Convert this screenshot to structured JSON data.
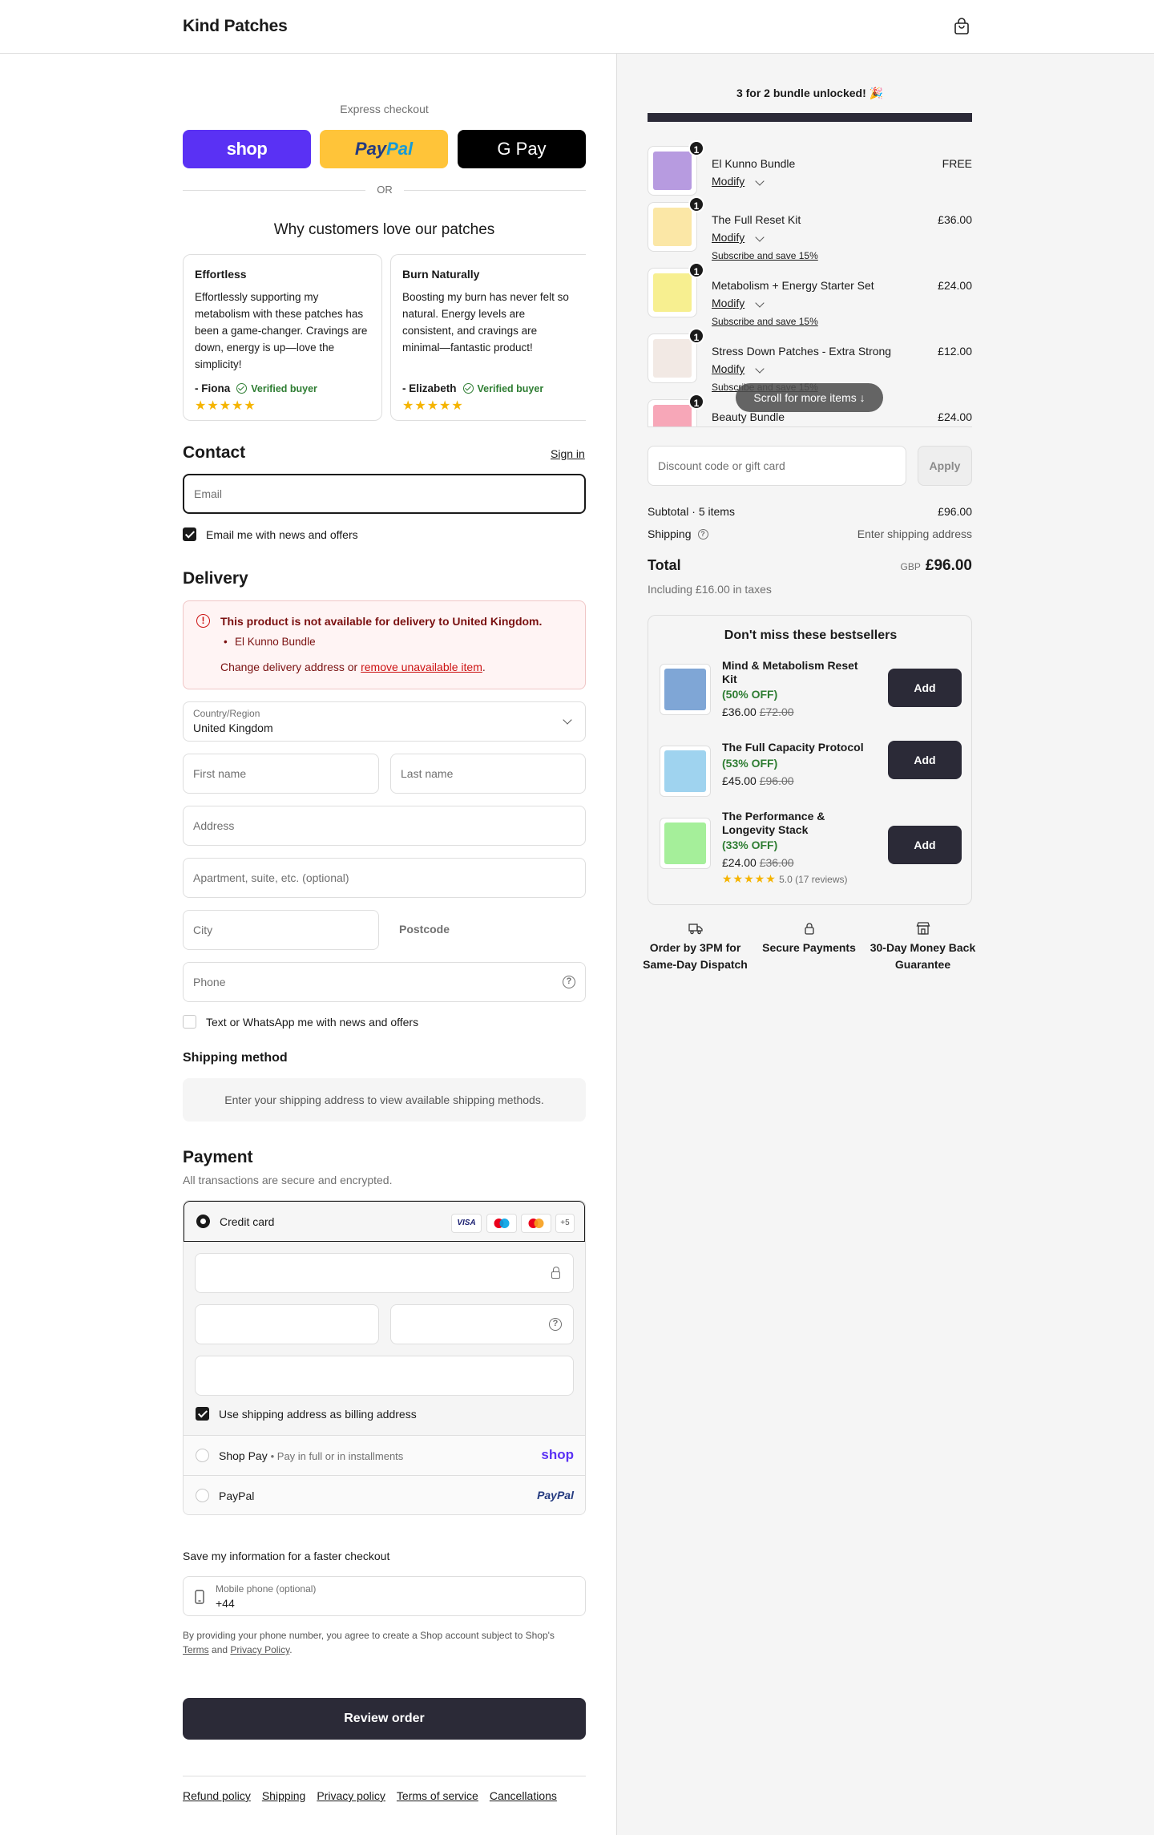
{
  "header": {
    "brand": "Kind Patches"
  },
  "express": {
    "label": "Express checkout",
    "shop": "shop",
    "paypal_a": "Pay",
    "paypal_b": "Pal",
    "gpay": "G Pay",
    "or": "OR"
  },
  "reviews": {
    "title": "Why customers love our patches",
    "items": [
      {
        "title": "Effortless",
        "text": "Effortlessly supporting my metabolism with these patches has been a game-changer. Cravings are down, energy is up—love the simplicity!",
        "author": "- Fiona",
        "verified": "Verified buyer",
        "stars": "★★★★★"
      },
      {
        "title": "Burn Naturally",
        "text": "Boosting my burn has never felt so natural. Energy levels are consistent, and cravings are minimal—fantastic product!",
        "author": "- Elizabeth",
        "verified": "Verified buyer",
        "stars": "★★★★★"
      }
    ]
  },
  "contact": {
    "title": "Contact",
    "signin": "Sign in",
    "email_placeholder": "Email",
    "news_label": "Email me with news and offers"
  },
  "delivery": {
    "title": "Delivery",
    "error_title": "This product is not available for delivery to United Kingdom.",
    "error_item": "El Kunno Bundle",
    "error_msg_a": "Change delivery address or ",
    "error_link": "remove unavailable item",
    "error_msg_b": ".",
    "country_label": "Country/Region",
    "country_value": "United Kingdom",
    "first_name": "First name",
    "last_name": "Last name",
    "address": "Address",
    "apartment": "Apartment, suite, etc. (optional)",
    "city": "City",
    "postcode": "Postcode",
    "phone": "Phone",
    "sms_label": "Text or WhatsApp me with news and offers"
  },
  "shipping_method": {
    "title": "Shipping method",
    "message": "Enter your shipping address to view available shipping methods."
  },
  "payment": {
    "title": "Payment",
    "subtitle": "All transactions are secure and encrypted.",
    "credit_card": "Credit card",
    "badges": [
      "VISA",
      "",
      "",
      "+5"
    ],
    "billing_label": "Use shipping address as billing address",
    "shop_pay": "Shop Pay",
    "shop_pay_sub": "Pay in full or in installments",
    "shop_logo": "shop",
    "paypal": "PayPal",
    "paypal_logo": "PayPal"
  },
  "save_info": {
    "title": "Save my information for a faster checkout",
    "mobile_label": "Mobile phone (optional)",
    "mobile_value": "+44",
    "legal_a": "By providing your phone number, you agree to create a Shop account subject to Shop's",
    "terms": "Terms",
    "and": "and",
    "privacy": "Privacy Policy",
    "period": "."
  },
  "review_button": "Review order",
  "footer_links": [
    "Refund policy",
    "Shipping",
    "Privacy policy",
    "Terms of service",
    "Cancellations"
  ],
  "cart": {
    "bundle_banner": "3 for 2 bundle unlocked! 🎉",
    "bundle_progress": 1.0,
    "items": [
      {
        "qty": "1",
        "name": "El Kunno Bundle",
        "price": "FREE",
        "modify": "Modify",
        "sub": "",
        "color": "#b79be0"
      },
      {
        "qty": "1",
        "name": "The Full Reset Kit",
        "price": "£36.00",
        "modify": "Modify",
        "sub": "Subscribe and save 15%",
        "color": "#fbe7a6"
      },
      {
        "qty": "1",
        "name": "Metabolism + Energy Starter Set",
        "price": "£24.00",
        "modify": "Modify",
        "sub": "Subscribe and save 15%",
        "color": "#f7ef90"
      },
      {
        "qty": "1",
        "name": "Stress Down Patches - Extra Strong",
        "price": "£12.00",
        "modify": "Modify",
        "sub": "Subscribe and save 15%",
        "color": "#f2e9e4"
      },
      {
        "qty": "1",
        "name": "Beauty Bundle",
        "price": "£24.00",
        "modify": "",
        "sub": "",
        "color": "#f7a7b8"
      }
    ],
    "scroll_hint": "Scroll for more items",
    "discount_placeholder": "Discount code or gift card",
    "apply": "Apply",
    "subtotal_label": "Subtotal · 5 items",
    "subtotal_value": "£96.00",
    "shipping_label": "Shipping",
    "shipping_value": "Enter shipping address",
    "total_label": "Total",
    "currency": "GBP",
    "total_value": "£96.00",
    "taxes": "Including £16.00 in taxes"
  },
  "bestsellers": {
    "title": "Don't miss these bestsellers",
    "items": [
      {
        "name": "Mind & Metabolism Reset Kit",
        "off": "(50% OFF)",
        "price": "£36.00",
        "old": "£72.00",
        "add": "Add",
        "rating": "",
        "color": "#7fa6d6"
      },
      {
        "name": "The Full Capacity Protocol",
        "off": "(53% OFF)",
        "price": "£45.00",
        "old": "£96.00",
        "add": "Add",
        "rating": "",
        "color": "#9fd3ef"
      },
      {
        "name": "The Performance & Longevity Stack",
        "off": "(33% OFF)",
        "price": "£24.00",
        "old": "£36.00",
        "add": "Add",
        "rating": "5.0 (17 reviews)",
        "color": "#a5ef9a"
      }
    ]
  },
  "trust": [
    {
      "icon": "truck-icon",
      "text": "Order by 3PM for Same-Day Dispatch"
    },
    {
      "icon": "lock-icon",
      "text": "Secure Payments"
    },
    {
      "icon": "store-icon",
      "text": "30-Day Money Back Guarantee"
    }
  ]
}
